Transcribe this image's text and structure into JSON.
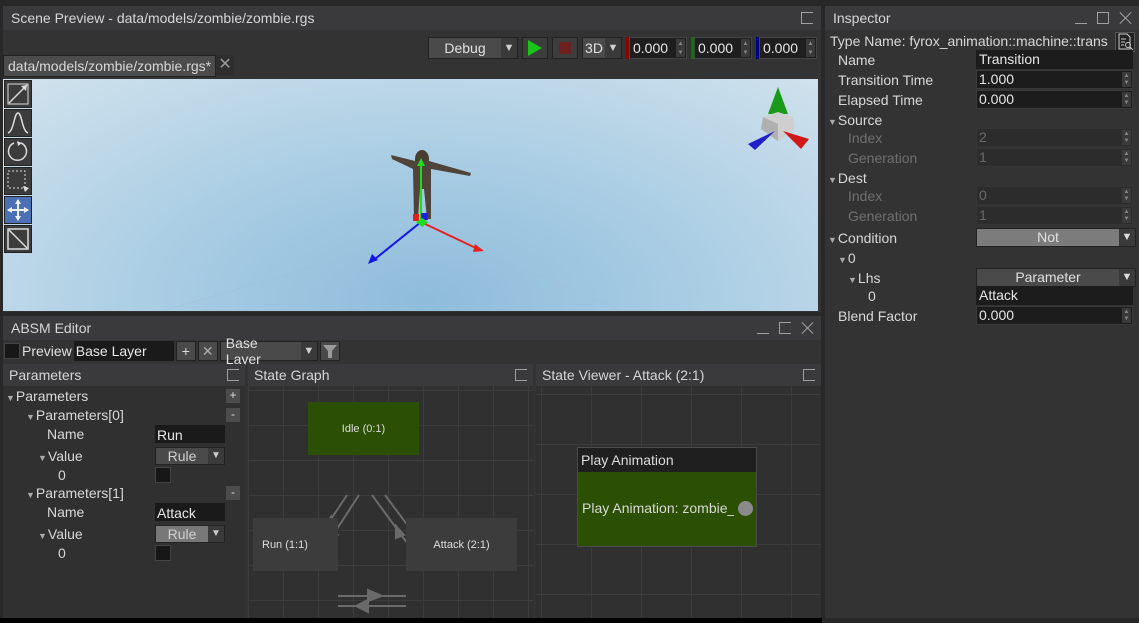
{
  "scene_preview": {
    "title": "Scene Preview - data/models/zombie/zombie.rgs",
    "toolbar": {
      "mode_dropdown": "Debug",
      "play_icon": "play-icon",
      "stop_icon": "stop-icon",
      "view_dropdown": "3D",
      "x_value": "0.000",
      "y_value": "0.000",
      "z_value": "0.000",
      "axis_colors": {
        "x": "#8b0000",
        "y": "#007a00",
        "z": "#00008b"
      }
    },
    "tabs": [
      {
        "label": "data/models/zombie/zombie.rgs*",
        "close_icon": "close-icon"
      }
    ],
    "tools": [
      {
        "name": "select-tool",
        "icon": "select-arrow-icon",
        "active": false
      },
      {
        "name": "terrain-tool",
        "icon": "terrain-icon",
        "active": false
      },
      {
        "name": "rotate-tool",
        "icon": "rotate-icon",
        "active": false
      },
      {
        "name": "region-select-tool",
        "icon": "region-select-icon",
        "active": false
      },
      {
        "name": "move-tool",
        "icon": "move-icon",
        "active": true
      },
      {
        "name": "scale-tool",
        "icon": "scale-icon",
        "active": false
      }
    ]
  },
  "absm_editor": {
    "title": "ABSM Editor",
    "toolbar": {
      "preview_label": "Preview",
      "layer_name": "Base Layer",
      "add_label": "+",
      "layer_dropdown": "Base Layer"
    },
    "parameters_panel": {
      "title": "Parameters",
      "root_label": "Parameters",
      "add_button": "+",
      "items": [
        {
          "header": "Parameters[0]",
          "remove_button": "-",
          "name_label": "Name",
          "name_value": "Run",
          "value_label": "Value",
          "value_type": "Rule",
          "index_label": "0",
          "checked": false
        },
        {
          "header": "Parameters[1]",
          "remove_button": "-",
          "name_label": "Name",
          "name_value": "Attack",
          "value_label": "Value",
          "value_type": "Rule",
          "index_label": "0",
          "checked": false
        }
      ]
    },
    "state_graph": {
      "title": "State Graph",
      "nodes": [
        {
          "label": "Idle (0:1)",
          "active": true
        },
        {
          "label": "Run (1:1)",
          "active": false
        },
        {
          "label": "Attack (2:1)",
          "active": false
        }
      ]
    },
    "state_viewer": {
      "title": "State Viewer - Attack (2:1)",
      "node_title": "Play Animation",
      "node_text": "Play Animation: zombie_"
    }
  },
  "inspector": {
    "title": "Inspector",
    "type_name": "Type Name: fyrox_animation::machine::trans",
    "fields": {
      "name_label": "Name",
      "name_value": "Transition",
      "transition_time_label": "Transition Time",
      "transition_time_value": "1.000",
      "elapsed_time_label": "Elapsed Time",
      "elapsed_time_value": "0.000",
      "source_label": "Source",
      "source_index_label": "Index",
      "source_index_value": "2",
      "source_generation_label": "Generation",
      "source_generation_value": "1",
      "dest_label": "Dest",
      "dest_index_label": "Index",
      "dest_index_value": "0",
      "dest_generation_label": "Generation",
      "dest_generation_value": "1",
      "condition_label": "Condition",
      "condition_value": "Not",
      "cond_index_label": "0",
      "lhs_label": "Lhs",
      "lhs_value": "Parameter",
      "lhs_index_label": "0",
      "lhs_param_value": "Attack",
      "blend_factor_label": "Blend Factor",
      "blend_factor_value": "0.000"
    }
  }
}
